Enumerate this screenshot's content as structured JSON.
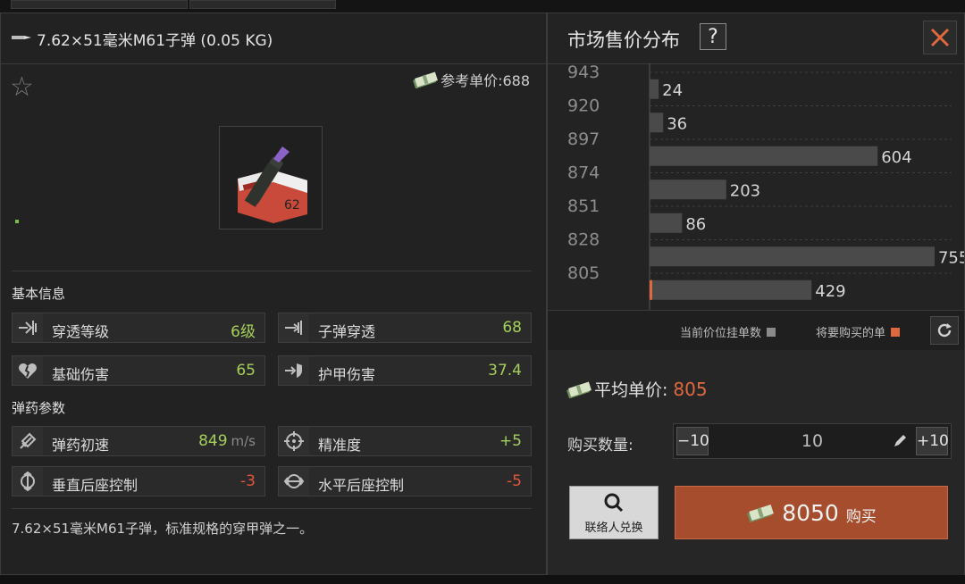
{
  "item": {
    "title": "7.62×51毫米M61子弹 (0.05 KG)",
    "ref_price_label": "参考单价:688",
    "description": "7.62×51毫米M61子弹，标准规格的穿甲弹之一。"
  },
  "sections": {
    "basic": "基本信息",
    "ammo": "弹药参数"
  },
  "stats": [
    {
      "label": "穿透等级",
      "value": "6级",
      "icon": "penetration-level-icon",
      "color": "#a4cf5a"
    },
    {
      "label": "子弹穿透",
      "value": "68",
      "icon": "bullet-penetration-icon",
      "color": "#a4cf5a"
    },
    {
      "label": "基础伤害",
      "value": "65",
      "icon": "broken-heart-icon",
      "color": "#a4cf5a"
    },
    {
      "label": "护甲伤害",
      "value": "37.4",
      "icon": "armor-damage-icon",
      "color": "#a4cf5a"
    }
  ],
  "ammo_stats": [
    {
      "label": "弹药初速",
      "value": "849",
      "unit": "m/s",
      "icon": "muzzle-velocity-icon",
      "color": "#a4cf5a"
    },
    {
      "label": "精准度",
      "value": "+5",
      "icon": "crosshair-icon",
      "color": "#a4cf5a"
    },
    {
      "label": "垂直后座控制",
      "value": "-3",
      "icon": "vertical-recoil-icon",
      "color": "#e0563b"
    },
    {
      "label": "水平后座控制",
      "value": "-5",
      "icon": "horizontal-recoil-icon",
      "color": "#e0563b"
    }
  ],
  "market": {
    "title": "市场售价分布",
    "help": "?",
    "legend_current": "当前价位挂单数",
    "legend_buy": "将要购买的单",
    "avg_label": "平均单价:",
    "avg_value": "805",
    "qty_label": "购买数量:",
    "qty_minus": "−10",
    "qty_value": "10",
    "qty_plus": "+10",
    "contact_label": "联络人兑换",
    "buy_price": "8050",
    "buy_label": "购买"
  },
  "colors": {
    "accent": "#e0683f",
    "green": "#a4cf5a",
    "bar": "#4a4a4a",
    "buy_button": "#a54d2c"
  },
  "chart_data": {
    "type": "bar",
    "orientation": "horizontal",
    "title": "市场售价分布",
    "categories": [
      "943",
      "920",
      "897",
      "874",
      "851",
      "828",
      "805"
    ],
    "values": [
      24,
      36,
      604,
      203,
      86,
      755,
      429
    ],
    "x_range": [
      0,
      800
    ],
    "grid": true
  }
}
